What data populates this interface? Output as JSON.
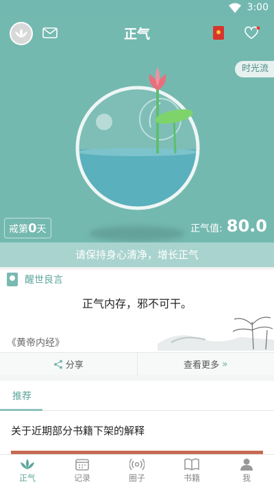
{
  "status_bar": {
    "time": "3:00"
  },
  "header": {
    "title": "正气"
  },
  "hero": {
    "timeline_label": "时光流",
    "abstain": {
      "prefix": "戒第",
      "days": "0",
      "suffix": "天"
    },
    "qi": {
      "label": "正气值:",
      "value": "80.0"
    }
  },
  "slogan": "请保持身心清净，增长正气",
  "quote": {
    "heading": "醒世良言",
    "text": "正气内存，邪不可干。",
    "source": "《黄帝内经》",
    "share_label": "分享",
    "more_label": "查看更多"
  },
  "recommend": {
    "tab_label": "推荐",
    "article_title": "关于近期部分书籍下架的解释"
  },
  "tabbar": {
    "items": [
      {
        "label": "正气",
        "icon": "lotus-icon",
        "active": true
      },
      {
        "label": "记录",
        "icon": "calendar-icon",
        "active": false
      },
      {
        "label": "圈子",
        "icon": "broadcast-icon",
        "active": false
      },
      {
        "label": "书籍",
        "icon": "book-icon",
        "active": false
      },
      {
        "label": "我",
        "icon": "person-icon",
        "active": false
      }
    ]
  },
  "colors": {
    "accent": "#74b9b0",
    "accent_dark": "#5ea49c",
    "lotus": "#e8707c"
  }
}
